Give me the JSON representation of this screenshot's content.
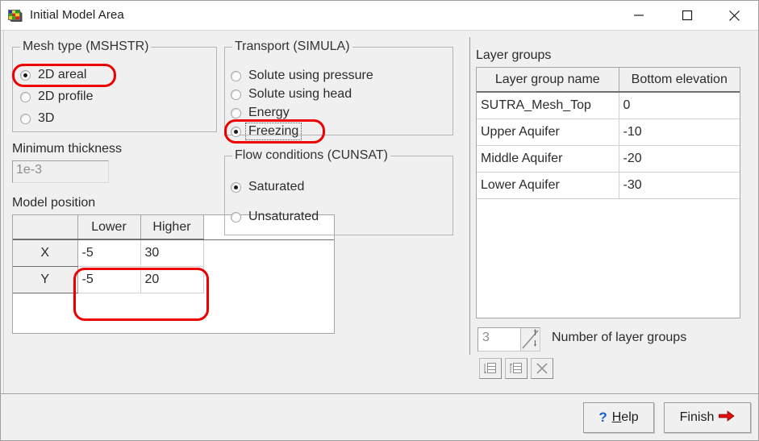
{
  "window": {
    "title": "Initial Model Area",
    "icon": "mesh-grid-icon",
    "minimize_label": "—",
    "maximize_label": "□",
    "close_label": "✕"
  },
  "mesh_type": {
    "legend": "Mesh type (MSHSTR)",
    "options": [
      {
        "label": "2D areal",
        "selected": true
      },
      {
        "label": "2D profile",
        "selected": false
      },
      {
        "label": "3D",
        "selected": false
      }
    ]
  },
  "minimum_thickness": {
    "label": "Minimum thickness",
    "value": "1e-3",
    "enabled": false
  },
  "model_position": {
    "label": "Model position",
    "columns": [
      "",
      "Lower",
      "Higher"
    ],
    "rows": [
      {
        "axis": "X",
        "lower": "-5",
        "higher": "30"
      },
      {
        "axis": "Y",
        "lower": "-5",
        "higher": "20"
      }
    ]
  },
  "transport": {
    "legend": "Transport (SIMULA)",
    "options": [
      {
        "label": "Solute using pressure",
        "selected": false,
        "focused": false
      },
      {
        "label": "Solute using head",
        "selected": false,
        "focused": false
      },
      {
        "label": "Energy",
        "selected": false,
        "focused": false
      },
      {
        "label": "Freezing",
        "selected": true,
        "focused": true
      }
    ]
  },
  "flow_conditions": {
    "legend": "Flow conditions (CUNSAT)",
    "options": [
      {
        "label": "Saturated",
        "selected": true
      },
      {
        "label": "Unsaturated",
        "selected": false
      }
    ]
  },
  "layer_groups": {
    "label": "Layer groups",
    "columns": [
      "Layer group name",
      "Bottom elevation"
    ],
    "rows": [
      {
        "name": "SUTRA_Mesh_Top",
        "bottom_elevation": "0"
      },
      {
        "name": "Upper Aquifer",
        "bottom_elevation": "-10"
      },
      {
        "name": "Middle Aquifer",
        "bottom_elevation": "-20"
      },
      {
        "name": "Lower Aquifer",
        "bottom_elevation": "-30"
      }
    ],
    "count_value": "3",
    "count_label": "Number of layer groups",
    "toolbar": [
      {
        "icon": "insert-row-below-icon",
        "enabled": false
      },
      {
        "icon": "insert-row-above-icon",
        "enabled": false
      },
      {
        "icon": "delete-row-icon",
        "enabled": false
      }
    ]
  },
  "footer": {
    "help_label": "Help",
    "help_accel": "H",
    "help_prefix": "?",
    "finish_label": "Finish",
    "finish_icon": "arrow-right-icon"
  },
  "annotations": {
    "accent_color": "#ee0000",
    "boxes": [
      {
        "target": "2D areal radio"
      },
      {
        "target": "Freezing radio"
      },
      {
        "target": "Model position X/Y values"
      }
    ]
  }
}
